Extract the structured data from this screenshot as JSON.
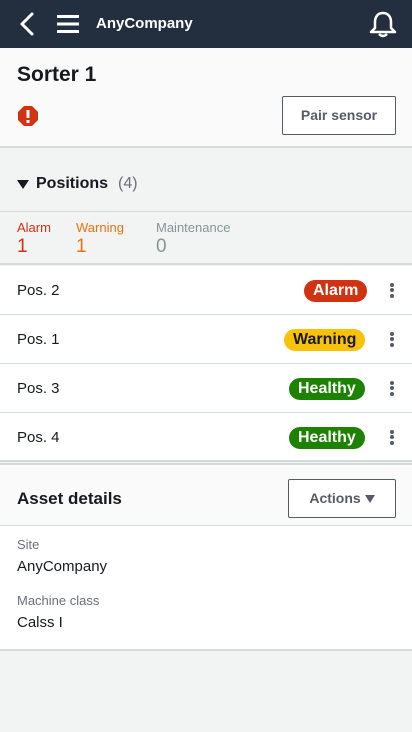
{
  "topbar": {
    "app_name": "AnyCompany"
  },
  "header": {
    "title": "Sorter 1",
    "pair_button": "Pair sensor"
  },
  "positions": {
    "label": "Positions",
    "count": "(4)",
    "summary": [
      {
        "label": "Alarm",
        "value": "1"
      },
      {
        "label": "Warning",
        "value": "1"
      },
      {
        "label": "Maintenance",
        "value": "0"
      }
    ],
    "rows": [
      {
        "name": "Pos. 2",
        "status": "Alarm"
      },
      {
        "name": "Pos. 1",
        "status": "Warning"
      },
      {
        "name": "Pos. 3",
        "status": "Healthy"
      },
      {
        "name": "Pos. 4",
        "status": "Healthy"
      }
    ]
  },
  "asset": {
    "title": "Asset details",
    "actions_button": "Actions",
    "fields": [
      {
        "label": "Site",
        "value": "AnyCompany"
      },
      {
        "label": "Machine class",
        "value": "Calss I"
      }
    ]
  },
  "colors": {
    "alarm": "#d13212",
    "warning": "#f8c10a",
    "healthy": "#1d8102",
    "topbar": "#232f3e"
  }
}
